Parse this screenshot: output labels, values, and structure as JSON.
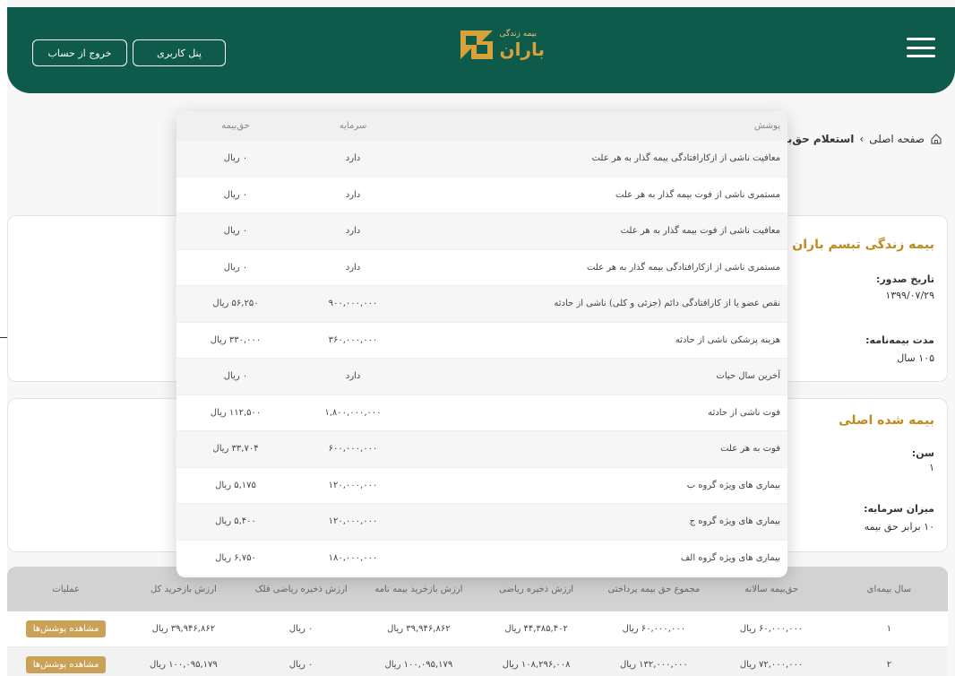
{
  "header": {
    "logo_small": "بیمه زندگی",
    "logo_big": "باران",
    "panel_label": "پنل کاربری",
    "exit_label": "خروج از حساب"
  },
  "breadcrumb": {
    "home": "صفحه اصلی",
    "separator": "›",
    "current": "استعلام حق‌بیمه"
  },
  "policy_card": {
    "title": "بیمه زندگی تبسم باران - کم ری",
    "issue_label": "تاریخ صدور:",
    "issue_value": "۱۳۹۹/۰۷/۲۹",
    "duration_label": "مدت بیمه‌نامه:",
    "duration_value": "۱۰۵ سال"
  },
  "insured_card": {
    "title": "بیمه شده اصلی",
    "age_label": "سن:",
    "age_value": "۱",
    "capital_label": "میزان سرمایه:",
    "capital_value": "۱۰ برابر حق بیمه"
  },
  "modal": {
    "headers": {
      "cover": "پوشش",
      "capital": "سرمایه",
      "premium": "حق‌بیمه"
    },
    "rows": [
      {
        "cover": "معافیت ناشی از ازکارافتادگی بیمه گذار به هر علت",
        "capital": "دارد",
        "premium": "۰ ریال"
      },
      {
        "cover": "مستمری ناشی از فوت بیمه گذار به هر علت",
        "capital": "دارد",
        "premium": "۰ ریال"
      },
      {
        "cover": "معافیت ناشی از فوت بیمه گذار به هر علت",
        "capital": "دارد",
        "premium": "۰ ریال"
      },
      {
        "cover": "مستمری ناشی از ازکارافتادگی بیمه گذار به هر علت",
        "capital": "دارد",
        "premium": "۰ ریال"
      },
      {
        "cover": "نقص عضو یا از کارافتادگی دائم (جزئی و کلی) ناشی از حادثه",
        "capital": "۹۰۰,۰۰۰,۰۰۰",
        "premium": "۵۶,۲۵۰ ریال"
      },
      {
        "cover": "هزینه پزشکی ناشی از حادثه",
        "capital": "۳۶۰,۰۰۰,۰۰۰",
        "premium": "۳۳۰,۰۰۰ ریال"
      },
      {
        "cover": "آخرین سال حیات",
        "capital": "دارد",
        "premium": "۰ ریال"
      },
      {
        "cover": "فوت ناشی از حادثه",
        "capital": "۱,۸۰۰,۰۰۰,۰۰۰",
        "premium": "۱۱۲,۵۰۰ ریال"
      },
      {
        "cover": "فوت به هر علت",
        "capital": "۶۰۰,۰۰۰,۰۰۰",
        "premium": "۳۳,۷۰۴ ریال"
      },
      {
        "cover": "بیماری های ویژه گروه ب",
        "capital": "۱۲۰,۰۰۰,۰۰۰",
        "premium": "۵,۱۷۵ ریال"
      },
      {
        "cover": "بیماری های ویژه گروه ج",
        "capital": "۱۲۰,۰۰۰,۰۰۰",
        "premium": "۵,۴۰۰ ریال"
      },
      {
        "cover": "بیماری های ویژه گروه الف",
        "capital": "۱۸۰,۰۰۰,۰۰۰",
        "premium": "۶,۷۵۰ ریال"
      }
    ]
  },
  "table": {
    "headers": [
      "سال بیمه‌ای",
      "حق‌بیمه سالانه",
      "مجموع حق بیمه پرداختی",
      "ارزش ذخیره ریاضی",
      "ارزش بازخرید بیمه نامه",
      "ارزش ذخیره ریاضی فلک",
      "ارزش بازخرید کل",
      "عملیات"
    ],
    "rows": [
      [
        "۱",
        "۶۰,۰۰۰,۰۰۰ ریال",
        "۶۰,۰۰۰,۰۰۰ ریال",
        "۴۴,۳۸۵,۴۰۲ ریال",
        "۳۹,۹۴۶,۸۶۲ ریال",
        "۰ ریال",
        "۳۹,۹۴۶,۸۶۲ ریال",
        "مشاهده پوشش‌ها"
      ],
      [
        "۲",
        "۷۲,۰۰۰,۰۰۰ ریال",
        "۱۳۲,۰۰۰,۰۰۰ ریال",
        "۱۰۸,۲۹۶,۰۰۸ ریال",
        "۱۰۰,۰۹۵,۱۷۹ ریال",
        "۰ ریال",
        "۱۰۰,۰۹۵,۱۷۹ ریال",
        "مشاهده پوشش‌ها"
      ]
    ]
  },
  "colors": {
    "header_green": "#0e5a4b",
    "gold": "#c18a1e",
    "button_gold": "#c9a257"
  }
}
